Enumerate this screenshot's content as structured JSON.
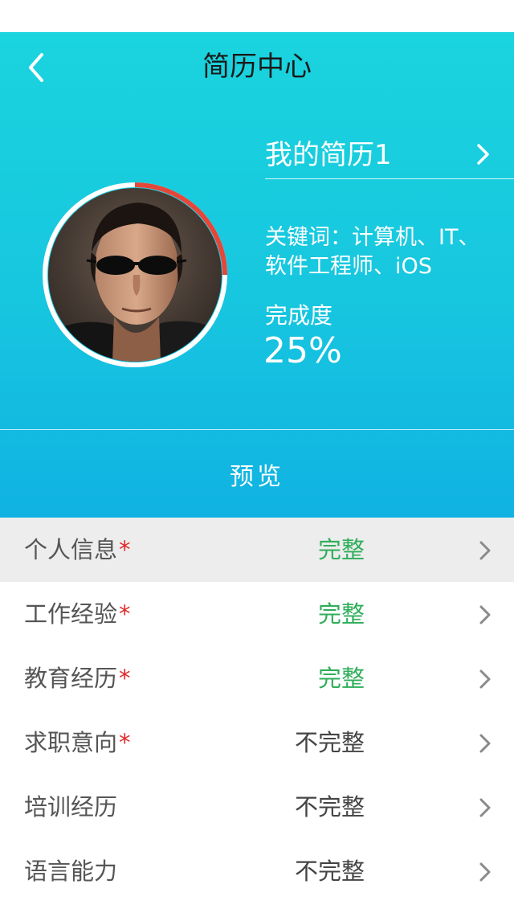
{
  "nav": {
    "title": "简历中心"
  },
  "resume": {
    "name": "我的简历1",
    "keywords_line1": "关键词：计算机、IT、",
    "keywords_line2": "软件工程师、iOS",
    "completion_label": "完成度",
    "completion_value": "25%",
    "completion_fraction": 0.25
  },
  "preview_label": "预览",
  "colors": {
    "complete": "#2fae5a",
    "incomplete": "#444444",
    "required_mark": "#e02a2a",
    "progress_ring": "#e4473a"
  },
  "sections": [
    {
      "label": "个人信息",
      "required": "*",
      "status": "完整"
    },
    {
      "label": "工作经验",
      "required": "*",
      "status": "完整"
    },
    {
      "label": "教育经历",
      "required": "*",
      "status": "完整"
    },
    {
      "label": "求职意向",
      "required": "*",
      "status": "不完整"
    },
    {
      "label": "培训经历",
      "required": "",
      "status": "不完整"
    },
    {
      "label": "语言能力",
      "required": "",
      "status": "不完整"
    }
  ]
}
